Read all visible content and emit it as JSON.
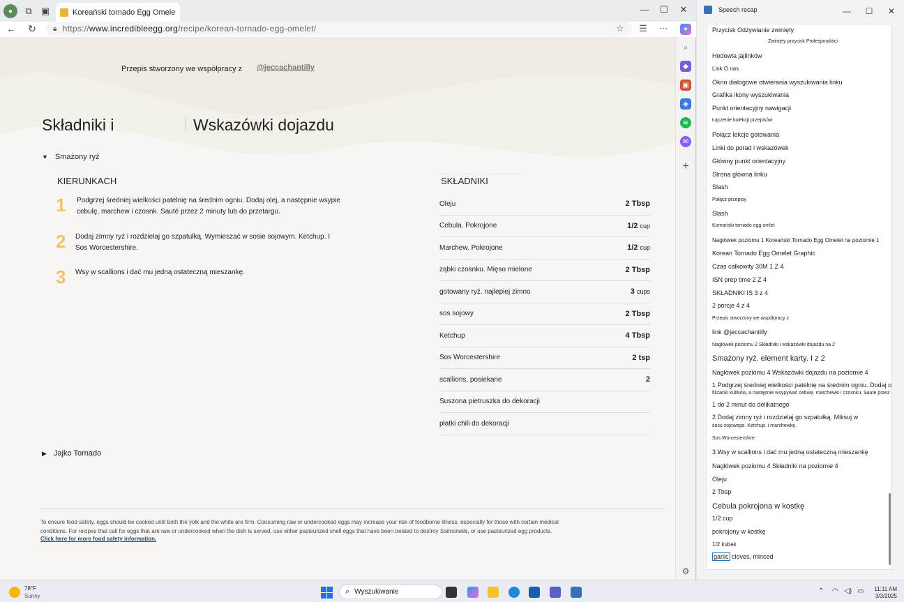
{
  "browser": {
    "tab_title": "Koreański tornado Egg Omelet . ; x +",
    "url_prefix": "https://",
    "url_domain": "www.incredibleegg.org",
    "url_path": "/recipe/korean-tornado-egg-omelet/"
  },
  "page": {
    "collab_text": "Przepis stworzony we współpracy z",
    "collab_link": "@jeccachantilly",
    "heading_ingredients": "Składniki i",
    "heading_directions": "Wskazówki dojazdu",
    "section1_title": "Smażony ryż",
    "directions_heading": "KIERUNKACH",
    "steps": [
      {
        "num": "1",
        "text": "Podgrzej średniej wielkości patelnię na średnim ogniu. Dodaj olej, a następnie wsypie cebulę, marchew i czosnk. Sauté przez 2 minuty lub do przetargu."
      },
      {
        "num": "2",
        "text": "Dodaj zimny ryż i rozdzielaj go szpatułką. Wymieszać w sosie sojowym. Ketchup. I Sos Worcestershire."
      },
      {
        "num": "3",
        "text": "Wsy w scallions i dać mu jedną ostateczną mieszankę."
      }
    ],
    "ingredients_heading": "SKŁADNIKI",
    "ingredients": [
      {
        "name": "Oleju",
        "amount": "2 Tbsp",
        "unit": ""
      },
      {
        "name": "Cebula. Pokrojone",
        "amount": "1/2",
        "unit": "cup"
      },
      {
        "name": "Marchew. Pokrojone",
        "amount": "1/2",
        "unit": "cup"
      },
      {
        "name": "ząbki czosnku. Mięso mielone",
        "amount": "2 Tbsp",
        "unit": ""
      },
      {
        "name": "gotowany ryż. najlepiej zimno",
        "amount": "3",
        "unit": "cups"
      },
      {
        "name": "sos sojowy",
        "amount": "2 Tbsp",
        "unit": ""
      },
      {
        "name": "Ketchup",
        "amount": "4 Tbsp",
        "unit": ""
      },
      {
        "name": "Sos Worcestershire",
        "amount": "2 tsp",
        "unit": ""
      },
      {
        "name": "scallions, posiekane",
        "amount": "2",
        "unit": ""
      },
      {
        "name": "Suszona pietruszka do dekoracji",
        "amount": "",
        "unit": ""
      },
      {
        "name": "płatki chili do dekoracji",
        "amount": "",
        "unit": ""
      }
    ],
    "section2_title": "Jajko Tornado",
    "footer_text_1": "To ensure food safety, eggs should be cooked until both the yolk and the white are firm. Consuming raw or undercooked eggs may increase your risk of foodborne illness, especially for those with certain medical",
    "footer_text_2a": "conditions. For recipes that call for eggs that are raw or undercooked when the dish is served, use either pasteurized shell eggs that have been treated to destroy ",
    "footer_text_2b": "Salmonella",
    "footer_text_2c": ", or use pasteurized egg products.",
    "footer_link": "Click here for more food safety information."
  },
  "recap": {
    "title": "Speech recap",
    "lines": [
      "Przycisk Odżywianie zwinięty",
      "Zwinięty przycisk Profesjonaliści",
      "Hodowla jajlinków",
      "Link O nas",
      "Okno dialogowe otwierania wyszukiwania linku",
      "Grafika ikony wyszukiwania",
      "Punkt orientacyjny nawigacji",
      "Łączenie kolekcji przepisów",
      "Połącz lekcje gotowania",
      "Linki do porad i wskazówek",
      "Główny punkt orientacyjny",
      "Strona główna linku",
      "Slash",
      "Połącz przepisy",
      "Slash",
      "Koreański tornado egg omlet",
      "Nagłówek poziomu 1 Koreański Tornado Egg Omelet na poziomie 1",
      "Korean Tornado Egg Omelet Graphic",
      "Czas całkowity 30M 1 Z 4",
      "ISN prep time 2 Z 4",
      "SKŁADNIKI IS 3 z 4",
      "porcje 4 z 4",
      "Przepis stworzony we współpracy z",
      "link @jeccachantilly",
      "Nagłówek poziomu 2 Składniki i wskazówki dojazdu na 2",
      "Smażony ryż. element karty. I z 2",
      "Nagłówek poziomu 4 Wskazówki dojazdu na poziomie 4",
      "Podgrzej średniej wielkości patelnię na średnim ogniu. Dodaj olej",
      "filiżanki kubków, a następnie wsypywać cebulę. marchewki i czosnku. Sauté przez",
      "1 do 2 minut do delikatnego",
      "Dodaj zimny ryż i rozdzielaj go szpatułką. Miksuj w",
      "sosu sojowego. Ketchup. i marchewkę.",
      "Sos Worcestershire",
      "Wsy w scallions i dać mu jedną ostateczną mieszankę",
      "Nagłówek poziomu 4 Składniki na poziomie 4",
      "Oleju",
      "2 Tbsp",
      "Cebula pokrojona w kostkę",
      "cup",
      "pokrojony w kostkę",
      "kubek",
      "garlic",
      "cloves, minced"
    ],
    "nums": {
      "n1": "1",
      "n2": "2",
      "n3": "3",
      "n4": "2",
      "half1": "1/2",
      "half2": "1/2"
    }
  },
  "taskbar": {
    "temp": "78°F",
    "weather": "Sunny",
    "search_placeholder": "Wyszukiwanie",
    "time": "11:11 AM",
    "date": "3/3/2025"
  },
  "colors": {
    "accent": "#f2c26b",
    "link_blue": "#2b4d7a",
    "start_blue": "#1a73e8"
  }
}
